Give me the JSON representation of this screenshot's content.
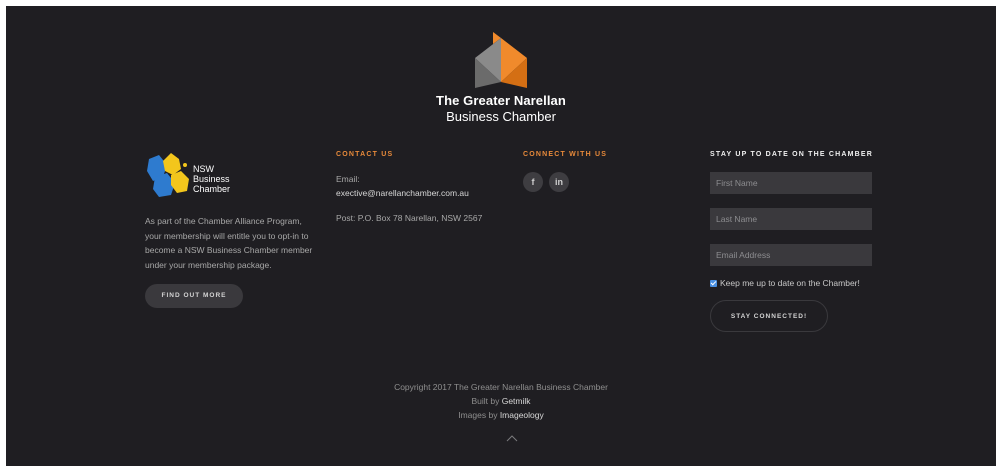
{
  "brand": {
    "name_line1": "The Greater Narellan",
    "name_line2": "Business Chamber",
    "colors": {
      "orange": "#f08a2c",
      "grey": "#8a8a8a"
    }
  },
  "nsw": {
    "logo_text_1": "NSW",
    "logo_text_2": "Business",
    "logo_text_3": "Chamber",
    "description": "As part of the Chamber Alliance Program, your membership will entitle you to opt-in to become a NSW Business Chamber member under your membership package.",
    "button_label": "FIND OUT MORE"
  },
  "contact": {
    "heading": "CONTACT US",
    "email_label": "Email:",
    "email": "exective@narellanchamber.com.au",
    "post": "Post: P.O. Box 78 Narellan, NSW 2567"
  },
  "connect": {
    "heading": "CONNECT WITH US",
    "social": [
      {
        "icon": "facebook-icon",
        "glyph": "f"
      },
      {
        "icon": "linkedin-icon",
        "glyph": "in"
      }
    ]
  },
  "subscribe": {
    "heading": "STAY UP TO DATE ON THE CHAMBER",
    "first_name_placeholder": "First Name",
    "last_name_placeholder": "Last Name",
    "email_placeholder": "Email Address",
    "checkbox_label": "Keep me up to date on the Chamber!",
    "checkbox_checked": true,
    "button_label": "STAY CONNECTED!"
  },
  "footer": {
    "copyright": "Copyright 2017 The Greater Narellan Business Chamber",
    "built_by_prefix": "Built by ",
    "built_by_link": "Getmilk",
    "images_by_prefix": "Images by ",
    "images_by_link": "Imageology"
  }
}
